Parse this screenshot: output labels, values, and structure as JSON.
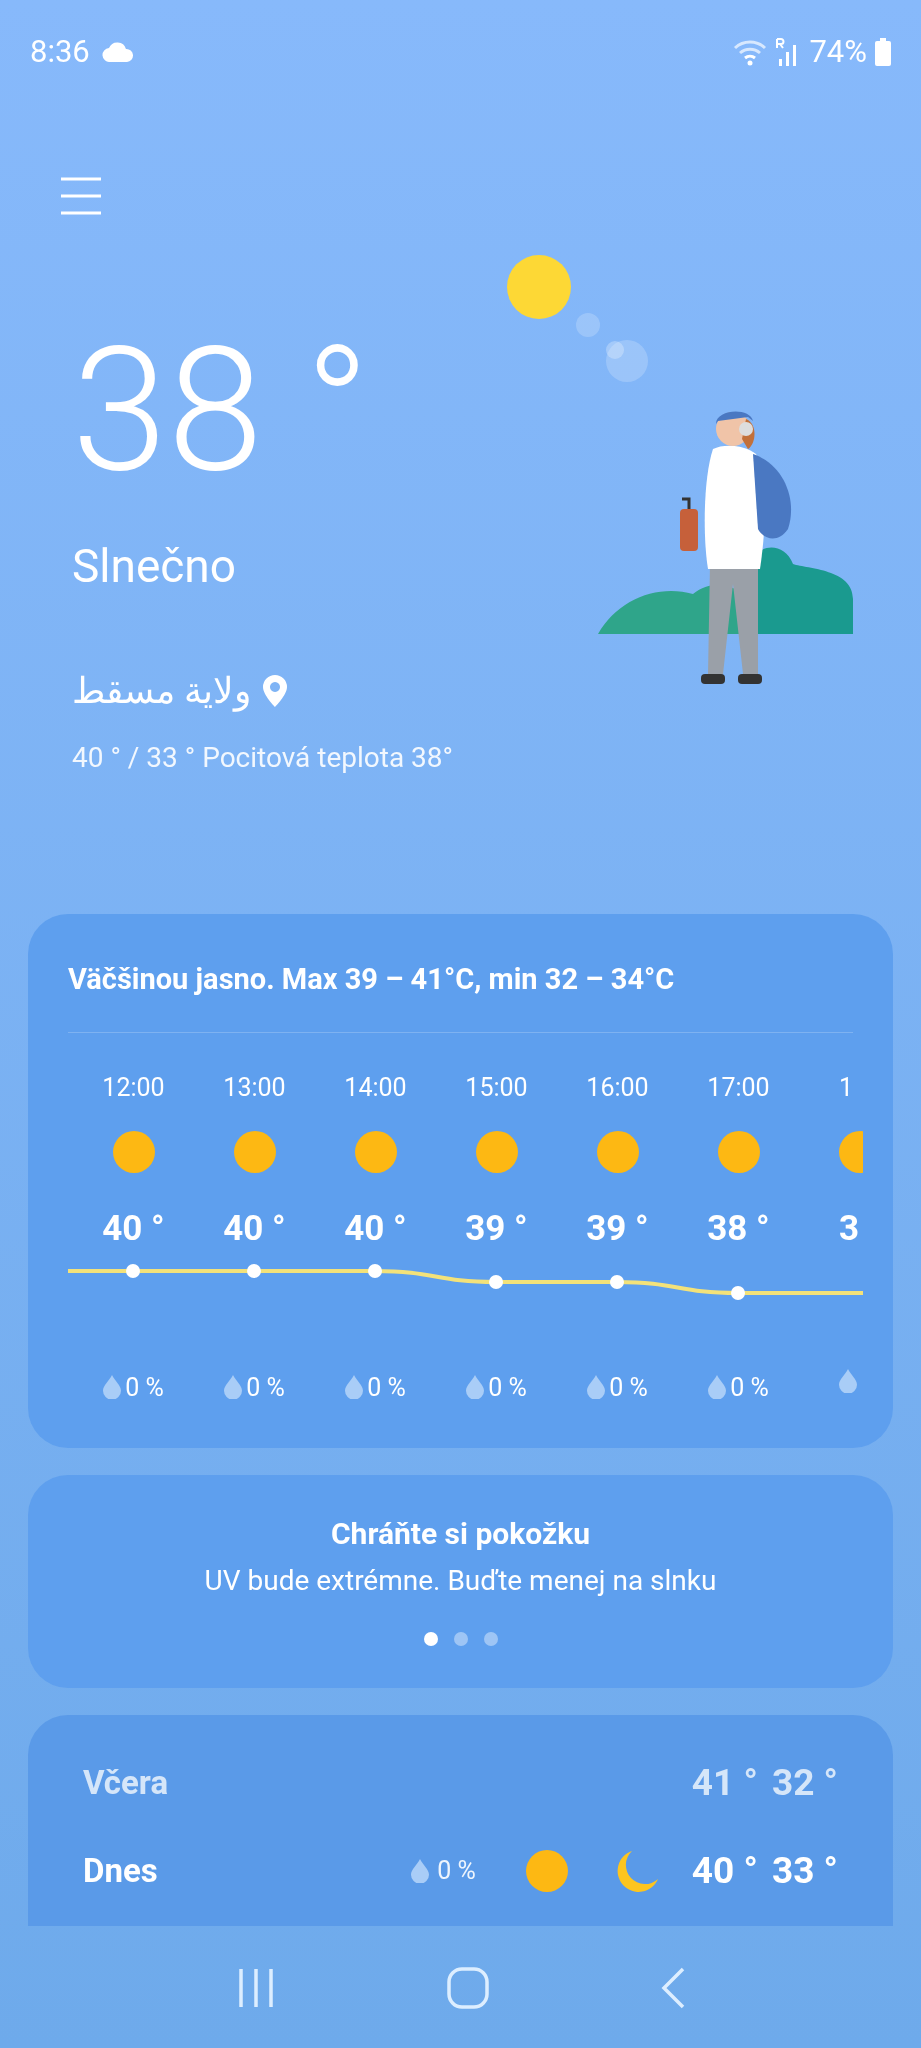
{
  "status_bar": {
    "time": "8:36",
    "battery": "74%"
  },
  "current": {
    "temperature": "38 °",
    "condition": "Slnečno",
    "location": "ولاية مسقط",
    "details": "40 ° / 33 ° Pocitová teplota 38°"
  },
  "hourly": {
    "summary": "Väčšinou jasno. Max 39 – 41°C, min 32 – 34°C",
    "hours": [
      {
        "time": "12:00",
        "temp": "40 °",
        "precip": "0 %"
      },
      {
        "time": "13:00",
        "temp": "40 °",
        "precip": "0 %"
      },
      {
        "time": "14:00",
        "temp": "40 °",
        "precip": "0 %"
      },
      {
        "time": "15:00",
        "temp": "39 °",
        "precip": "0 %"
      },
      {
        "time": "16:00",
        "temp": "39 °",
        "precip": "0 %"
      },
      {
        "time": "17:00",
        "temp": "38 °",
        "precip": "0 %"
      },
      {
        "time": "1",
        "temp": "3"
      }
    ]
  },
  "tip": {
    "title": "Chráňte si pokožku",
    "text": "UV bude extrémne. Buďte menej na slnku",
    "pages": [
      {
        "selected": true
      },
      {
        "selected": false
      },
      {
        "selected": false
      }
    ]
  },
  "daily": [
    {
      "day": "Včera",
      "past": true,
      "high": "41 °",
      "low": "32 °"
    },
    {
      "day": "Dnes",
      "past": false,
      "precip": "0 %",
      "high": "40 °",
      "low": "33 °"
    }
  ]
}
